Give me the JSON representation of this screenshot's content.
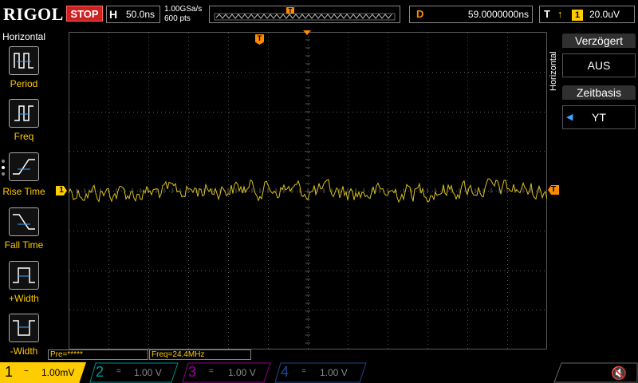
{
  "top": {
    "brand": "RIGOL",
    "run_state": "STOP",
    "horiz_letter": "H",
    "horiz_scale": "50.0ns",
    "sample_rate": "1.00GSa/s",
    "memory_depth": "600  pts",
    "trig_pos_marker": "T",
    "delay_letter": "D",
    "delay_value": "59.0000000ns",
    "trig_letter": "T",
    "trig_edge": "↑",
    "trig_source": "1",
    "trig_level": "20.0uV"
  },
  "left_menu": {
    "title": "Horizontal",
    "items": [
      {
        "label": "Period",
        "icon": "period-icon"
      },
      {
        "label": "Freq",
        "icon": "frequency-icon"
      },
      {
        "label": "Rise Time",
        "icon": "rise-time-icon"
      },
      {
        "label": "Fall Time",
        "icon": "fall-time-icon"
      },
      {
        "label": "+Width",
        "icon": "positive-width-icon"
      },
      {
        "label": "-Width",
        "icon": "negative-width-icon"
      }
    ]
  },
  "right_menu": {
    "vertical_title": "Horizontal",
    "delayed_title": "Verzögert",
    "delayed_value": "AUS",
    "timebase_title": "Zeitbasis",
    "timebase_value": "YT"
  },
  "markers": {
    "ch1_marker": "1",
    "trig_level_marker": "T",
    "trig_top_marker": "T"
  },
  "status": {
    "pre": "Pre=*****",
    "freq": "Freq=24.4MHz"
  },
  "channels": [
    {
      "num": "1",
      "coupling": "~",
      "scale": "1.00mV",
      "color": "#ffcc00",
      "active": true
    },
    {
      "num": "2",
      "coupling": "=",
      "scale": "1.00 V",
      "color": "#00ffff",
      "active": false
    },
    {
      "num": "3",
      "coupling": "=",
      "scale": "1.00 V",
      "color": "#ff00ff",
      "active": false
    },
    {
      "num": "4",
      "coupling": "=",
      "scale": "1.00 V",
      "color": "#3d7bff",
      "active": false
    }
  ],
  "colors": {
    "ch1": "#d8c020",
    "trigger": "#ff8a00",
    "grid": "#5a5a5a",
    "stop": "#cc2222"
  }
}
